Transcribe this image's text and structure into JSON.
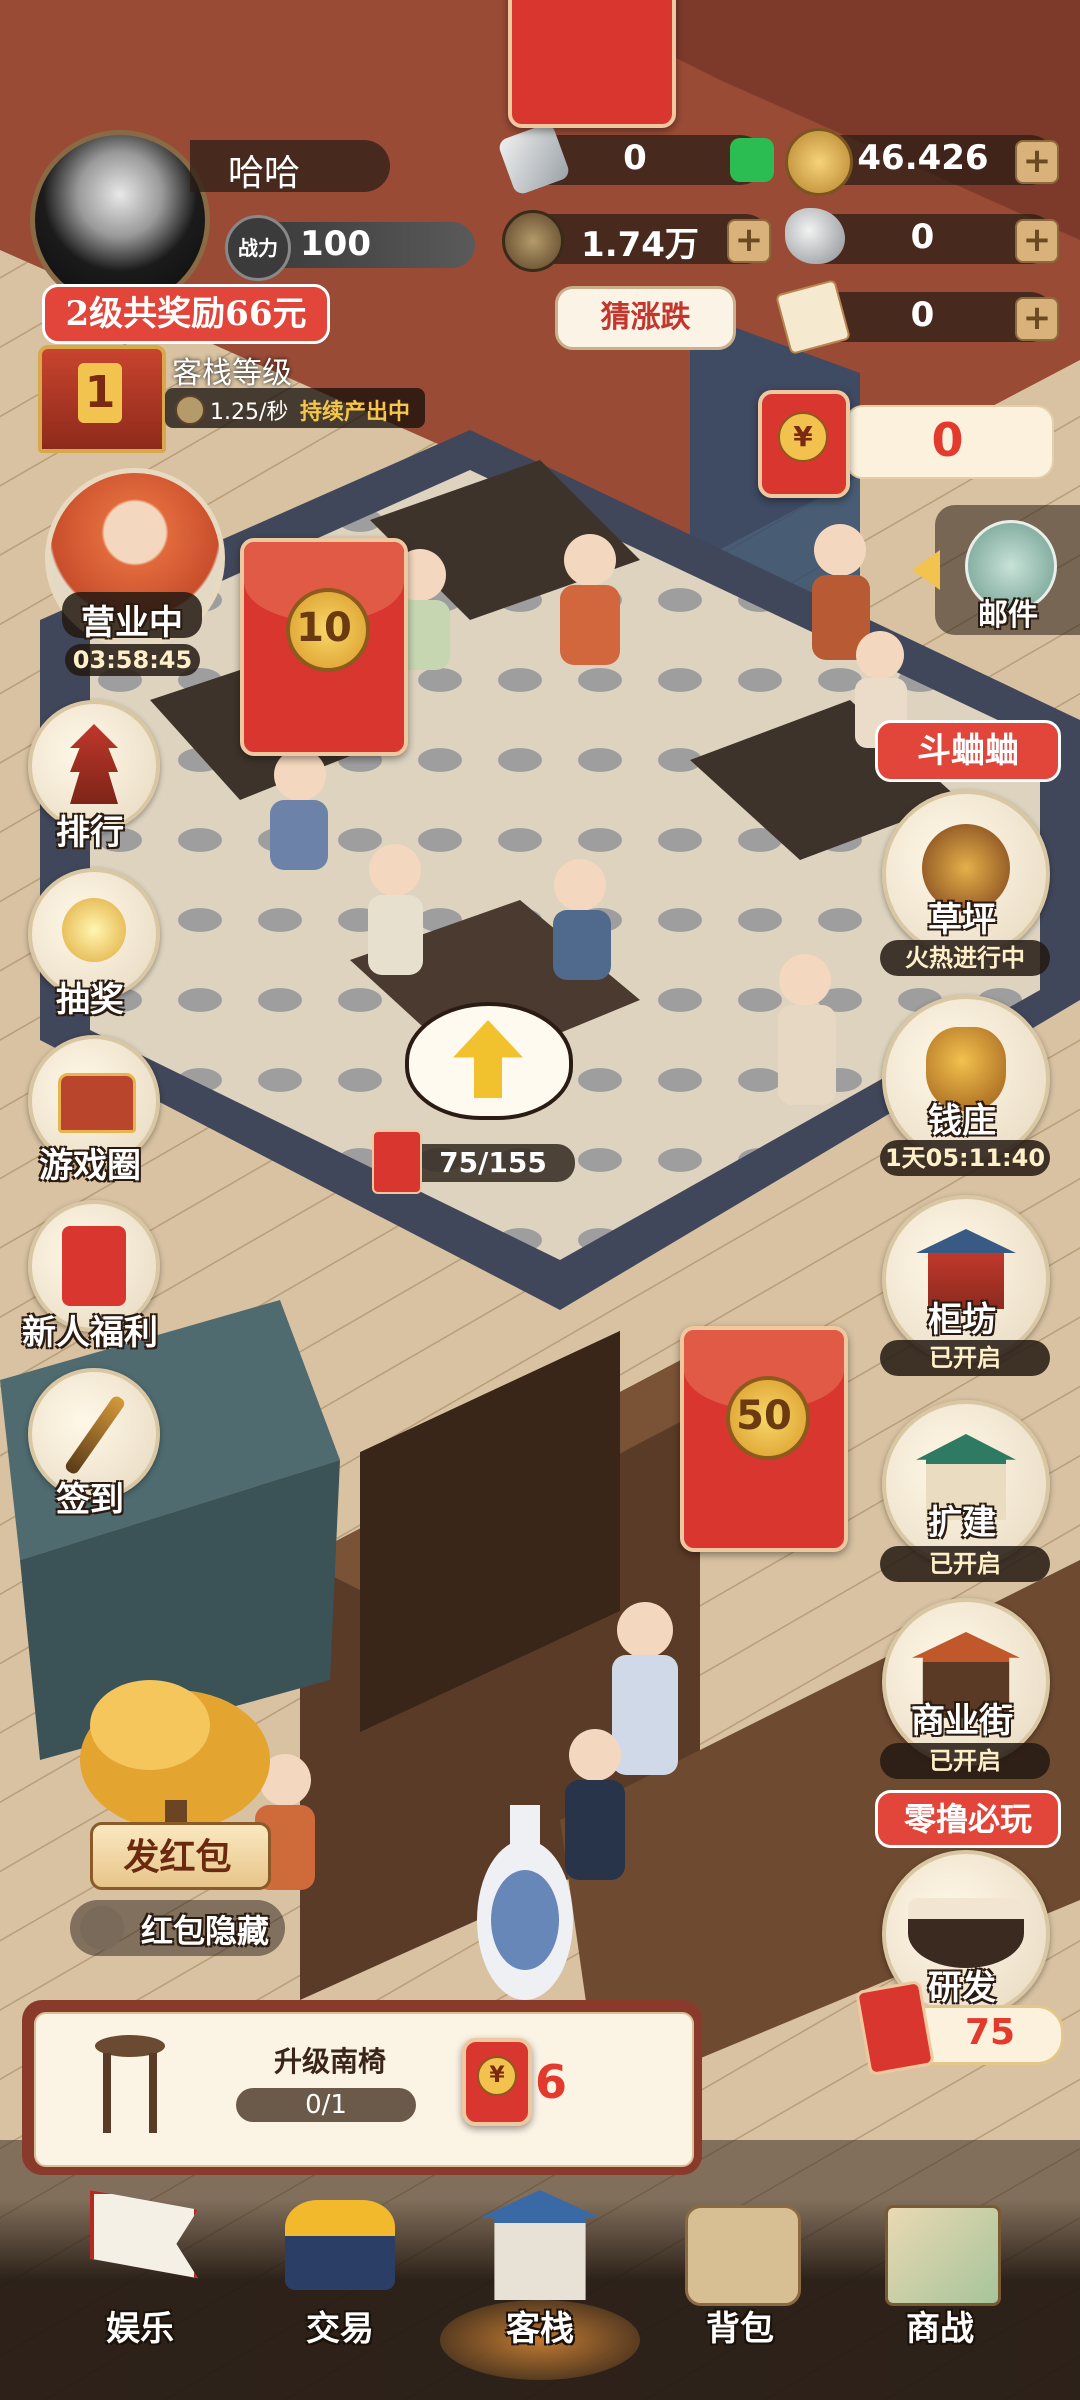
{
  "player": {
    "name": "哈哈",
    "power_label": "战力",
    "power_value": "100",
    "reward_banner": "2级共奖励66元"
  },
  "resources": {
    "wechat_count": "0",
    "gold_count": "46.426",
    "copper_count": "1.74万",
    "ore_count": "0",
    "guess_label": "猜涨跌",
    "ticket_count": "0",
    "red_packet_count": "0"
  },
  "inn": {
    "level_title": "客栈等级",
    "level": "1",
    "rate": "1.25/秒",
    "producing_text": "持续产出中"
  },
  "business": {
    "status": "营业中",
    "timer": "03:58:45"
  },
  "left_menu": [
    {
      "label": "排行"
    },
    {
      "label": "抽奖"
    },
    {
      "label": "游戏圈"
    },
    {
      "label": "新人福利"
    },
    {
      "label": "签到"
    }
  ],
  "floating_envelopes": {
    "left": "10",
    "middle": "50"
  },
  "upgrade_bubble": {
    "progress": "75/155"
  },
  "right_menu": {
    "mail": "邮件",
    "cricket_banner": "斗蛐蛐",
    "grass": {
      "label": "草坪",
      "status": "火热进行中"
    },
    "bank": {
      "label": "钱庄",
      "status": "1天05:11:40"
    },
    "cabinet": {
      "label": "柜坊",
      "status": "已开启"
    },
    "expand": {
      "label": "扩建",
      "status": "已开启"
    },
    "street": {
      "label": "商业街",
      "status": "已开启"
    },
    "snack_banner": "零撸必玩",
    "research": {
      "label": "研发",
      "count": "75"
    }
  },
  "red_packet": {
    "send_label": "发红包",
    "hide_label": "红包隐藏"
  },
  "task": {
    "title": "升级南椅",
    "progress": "0/1",
    "reward": "6"
  },
  "bottom_nav": [
    {
      "label": "娱乐"
    },
    {
      "label": "交易"
    },
    {
      "label": "客栈"
    },
    {
      "label": "背包"
    },
    {
      "label": "商战"
    }
  ],
  "colors": {
    "accent_red": "#e2453a",
    "gold": "#f2c14e",
    "panel_dark": "#2a1c14"
  }
}
